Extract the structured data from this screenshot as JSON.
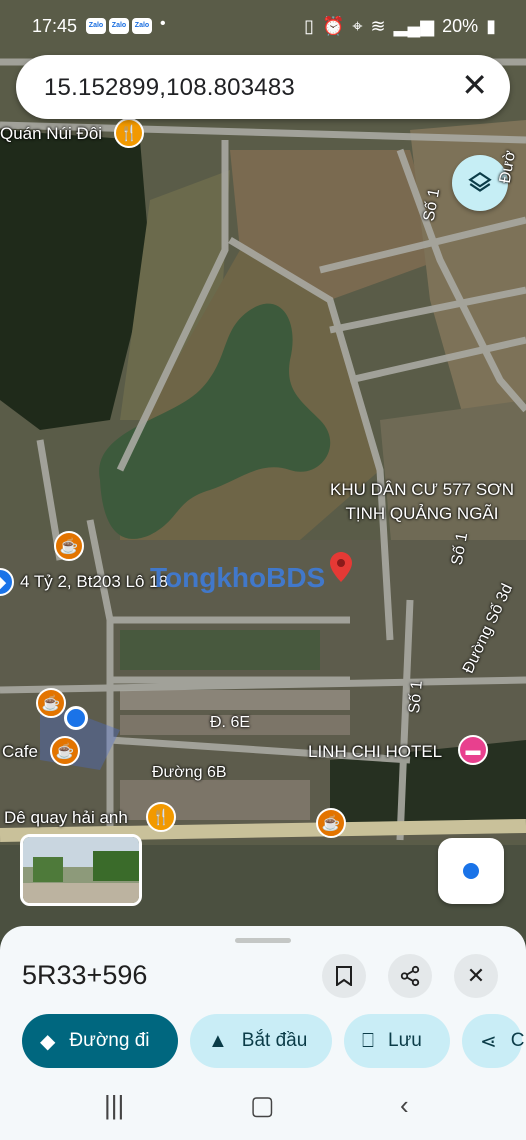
{
  "status": {
    "time": "17:45",
    "apps": [
      "Zalo",
      "Zalo",
      "Zalo"
    ],
    "battery": "20%"
  },
  "search": {
    "query": "15.152899,108.803483"
  },
  "map": {
    "labels": {
      "quan_nui_doi": "Quán Núi Đôi",
      "khu_dan_cu": "KHU DÂN CƯ 577 SƠN TỊNH QUẢNG NGÃI",
      "address": "4 Tỷ 2, Bt203 Lô 18",
      "cafe": "Cafe",
      "de_quay": "Dê quay hải anh",
      "linh_chi": "LINH CHI HOTEL",
      "watermark": "TongkhoBDS"
    },
    "roads": {
      "so1_a": "Số 1",
      "so1_b": "Số 1",
      "so1_c": "Số 1",
      "duong_top": "Đườ",
      "duong_so3d": "Đường Số 3d",
      "d6e": "Đ. 6E",
      "duong6b": "Đường 6B"
    }
  },
  "sheet": {
    "plus_code": "5R33+596",
    "chips": {
      "directions": "Đường đi",
      "start": "Bắt đầu",
      "save": "Lưu",
      "share": "C"
    }
  },
  "colors": {
    "primary": "#00677f",
    "secondary": "#c9edf6",
    "food_pin": "#f29900",
    "hotel_pin": "#e8408e",
    "location_blue": "#1a73e8"
  }
}
